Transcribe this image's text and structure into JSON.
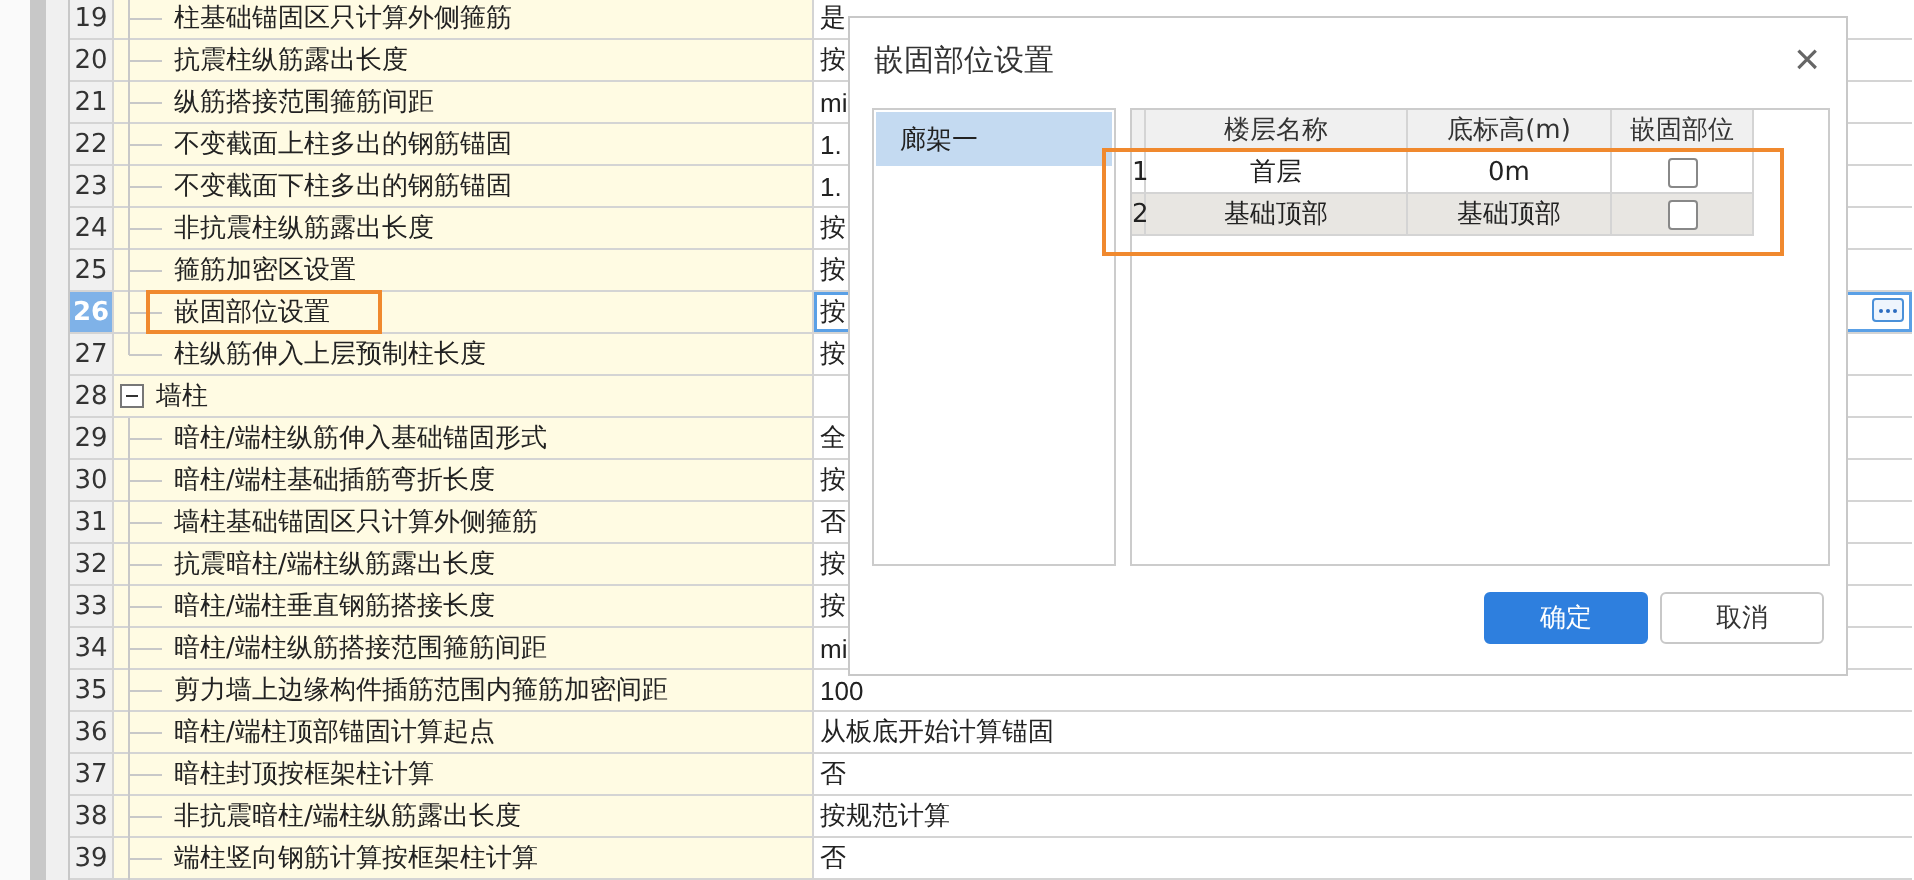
{
  "grid": {
    "rows": [
      {
        "number": "19",
        "kind": "item",
        "label": "柱基础锚固区只计算外侧箍筋",
        "value": "是",
        "selected": false
      },
      {
        "number": "20",
        "kind": "item",
        "label": "抗震柱纵筋露出长度",
        "value": "按",
        "selected": false
      },
      {
        "number": "21",
        "kind": "item",
        "label": "纵筋搭接范围箍筋间距",
        "value": "mi",
        "selected": false
      },
      {
        "number": "22",
        "kind": "item",
        "label": "不变截面上柱多出的钢筋锚固",
        "value": "1.",
        "selected": false
      },
      {
        "number": "23",
        "kind": "item",
        "label": "不变截面下柱多出的钢筋锚固",
        "value": "1.",
        "selected": false
      },
      {
        "number": "24",
        "kind": "item",
        "label": "非抗震柱纵筋露出长度",
        "value": "按",
        "selected": false
      },
      {
        "number": "25",
        "kind": "item",
        "label": "箍筋加密区设置",
        "value": "按",
        "selected": false
      },
      {
        "number": "26",
        "kind": "item",
        "label": "嵌固部位设置",
        "value": "按",
        "selected": true,
        "highlighted": true
      },
      {
        "number": "27",
        "kind": "item",
        "label": "柱纵筋伸入上层预制柱长度",
        "value": "按",
        "selected": false
      },
      {
        "number": "28",
        "kind": "group",
        "label": "墙柱",
        "expanded": true,
        "selected": false,
        "children": [
          {
            "number": "29",
            "kind": "item",
            "label": "暗柱/端柱纵筋伸入基础锚固形式",
            "value": "全",
            "selected": false
          },
          {
            "number": "30",
            "kind": "item",
            "label": "暗柱/端柱基础插筋弯折长度",
            "value": "按",
            "selected": false
          },
          {
            "number": "31",
            "kind": "item",
            "label": "墙柱基础锚固区只计算外侧箍筋",
            "value": "否",
            "selected": false
          },
          {
            "number": "32",
            "kind": "item",
            "label": "抗震暗柱/端柱纵筋露出长度",
            "value": "按",
            "selected": false
          },
          {
            "number": "33",
            "kind": "item",
            "label": "暗柱/端柱垂直钢筋搭接长度",
            "value": "按",
            "selected": false
          },
          {
            "number": "34",
            "kind": "item",
            "label": "暗柱/端柱纵筋搭接范围箍筋间距",
            "value": "mi",
            "selected": false
          },
          {
            "number": "35",
            "kind": "item",
            "label": "剪力墙上边缘构件插筋范围内箍筋加密间距",
            "value": "100",
            "selected": false
          },
          {
            "number": "36",
            "kind": "item",
            "label": "暗柱/端柱顶部锚固计算起点",
            "value": "从板底开始计算锚固",
            "selected": false
          },
          {
            "number": "37",
            "kind": "item",
            "label": "暗柱封顶按框架柱计算",
            "value": "否",
            "selected": false
          },
          {
            "number": "38",
            "kind": "item",
            "label": "非抗震暗柱/端柱纵筋露出长度",
            "value": "按规范计算",
            "selected": false
          },
          {
            "number": "39",
            "kind": "item",
            "label": "端柱竖向钢筋计算按框架柱计算",
            "value": "否",
            "selected": false
          }
        ]
      }
    ]
  },
  "dialog": {
    "title": "嵌固部位设置",
    "close": "×",
    "list": [
      {
        "label": "廊架一",
        "selected": true
      }
    ],
    "table": {
      "highlighted": true,
      "columns": [
        "楼层名称",
        "底标高(m)",
        "嵌固部位"
      ],
      "rows": [
        {
          "number": "1",
          "floor": "首层",
          "elevation": "0m",
          "checked": false,
          "selected": false
        },
        {
          "number": "2",
          "floor": "基础顶部",
          "elevation": "基础顶部",
          "checked": false,
          "selected": true
        }
      ]
    },
    "buttons": [
      {
        "label": "确定",
        "kind": "primary"
      },
      {
        "label": "取消",
        "kind": "default"
      }
    ]
  }
}
